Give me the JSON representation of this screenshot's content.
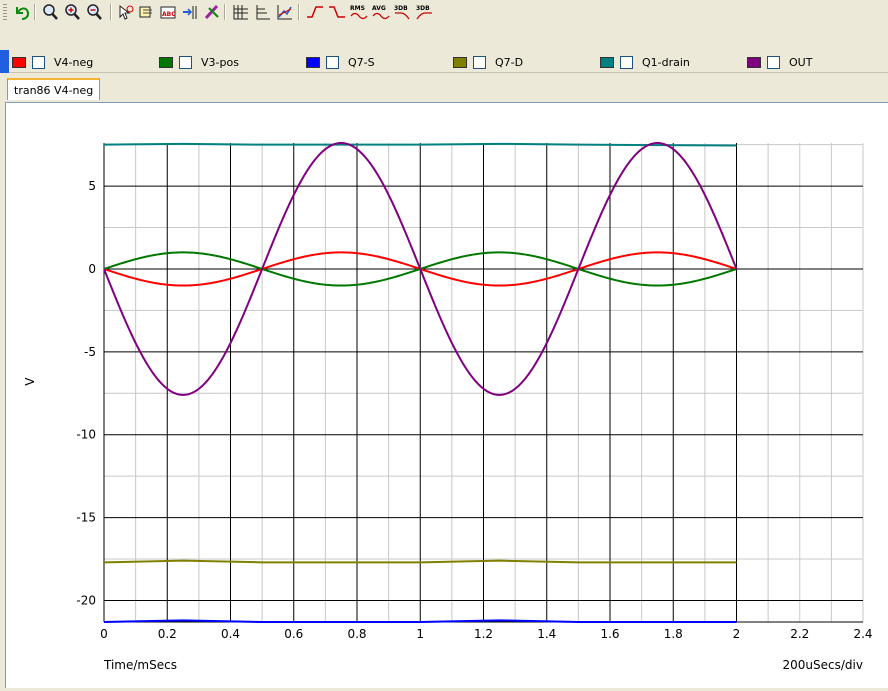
{
  "toolbar": {
    "buttons": [
      {
        "name": "undo",
        "icon": "undo-icon"
      },
      {
        "name": "zoom",
        "icon": "zoom-icon"
      },
      {
        "name": "zoom-in",
        "icon": "zoom-in-icon"
      },
      {
        "name": "zoom-out",
        "icon": "zoom-out-icon"
      },
      {
        "name": "cursor",
        "icon": "cursor-icon"
      },
      {
        "name": "pan",
        "icon": "pan-icon"
      },
      {
        "name": "label",
        "icon": "label-icon"
      },
      {
        "name": "insert",
        "icon": "insert-icon"
      },
      {
        "name": "marker",
        "icon": "marker-icon"
      },
      {
        "name": "grid",
        "icon": "grid-icon"
      },
      {
        "name": "axis",
        "icon": "axis-icon"
      },
      {
        "name": "scale",
        "icon": "scale-icon"
      },
      {
        "name": "rise",
        "icon": "rise-edge-icon"
      },
      {
        "name": "fall",
        "icon": "fall-edge-icon"
      },
      {
        "name": "rms",
        "icon": "rms-icon",
        "label": "RMS"
      },
      {
        "name": "avg",
        "icon": "avg-icon",
        "label": "AVG"
      },
      {
        "name": "3db-a",
        "icon": "3db-low-icon",
        "label": "3DB"
      },
      {
        "name": "3db-b",
        "icon": "3db-high-icon",
        "label": "3DB"
      }
    ]
  },
  "legend": [
    {
      "label": "V4-neg",
      "color": "#ff0000"
    },
    {
      "label": "V3-pos",
      "color": "#007700"
    },
    {
      "label": "Q7-S",
      "color": "#0000ff"
    },
    {
      "label": "Q7-D",
      "color": "#808000"
    },
    {
      "label": "Q1-drain",
      "color": "#008080"
    },
    {
      "label": "OUT",
      "color": "#800080"
    }
  ],
  "tab": {
    "label": "tran86 V4-neg"
  },
  "chart_data": {
    "type": "line",
    "xlabel": "Time/mSecs",
    "ylabel": "V",
    "xdiv_label": "200uSecs/div",
    "xlim": [
      0,
      2.4
    ],
    "ylim": [
      -21.3,
      7.6
    ],
    "xticks": [
      0,
      0.2,
      0.4,
      0.6,
      0.8,
      1,
      1.2,
      1.4,
      1.6,
      1.8,
      2,
      2.2,
      2.4
    ],
    "xtick_labels": [
      "0",
      "0.2",
      "0.4",
      "0.6",
      "0.8",
      "1",
      "1.2",
      "1.4",
      "1.6",
      "1.8",
      "2",
      "2.2",
      "2.4"
    ],
    "yticks": [
      5,
      0,
      -5,
      -10,
      -15,
      -20
    ],
    "ytick_labels": [
      "5",
      "0",
      "-5",
      "-10",
      "-15",
      "-20"
    ],
    "grid": true,
    "series": [
      {
        "name": "V4-neg",
        "color": "#ff0000",
        "x": [
          0,
          0.25,
          0.5,
          0.75,
          1,
          1.25,
          1.5,
          1.75,
          2
        ],
        "values": [
          0,
          -1,
          0,
          1,
          0,
          -1,
          0,
          1,
          0
        ]
      },
      {
        "name": "V3-pos",
        "color": "#007700",
        "x": [
          0,
          0.25,
          0.5,
          0.75,
          1,
          1.25,
          1.5,
          1.75,
          2
        ],
        "values": [
          0,
          1,
          0,
          -1,
          0,
          1,
          0,
          -1,
          0
        ]
      },
      {
        "name": "Q7-S",
        "color": "#0000ff",
        "x": [
          0,
          0.25,
          0.5,
          1,
          1.25,
          1.5,
          2
        ],
        "values": [
          -21.3,
          -21.2,
          -21.3,
          -21.3,
          -21.2,
          -21.3,
          -21.3
        ]
      },
      {
        "name": "Q7-D",
        "color": "#808000",
        "x": [
          0,
          0.25,
          0.5,
          1,
          1.25,
          1.5,
          2
        ],
        "values": [
          -17.7,
          -17.6,
          -17.7,
          -17.7,
          -17.6,
          -17.7,
          -17.7
        ]
      },
      {
        "name": "Q1-drain",
        "color": "#008080",
        "x": [
          0,
          0.25,
          0.5,
          1,
          1.25,
          1.5,
          2
        ],
        "values": [
          7.5,
          7.55,
          7.5,
          7.5,
          7.55,
          7.5,
          7.45
        ]
      },
      {
        "name": "OUT",
        "color": "#800080",
        "x": [
          0,
          0.25,
          0.5,
          0.75,
          1,
          1.25,
          1.5,
          1.75,
          2
        ],
        "values": [
          0,
          -7.6,
          0,
          7.6,
          0,
          -7.6,
          0,
          7.6,
          0
        ]
      }
    ]
  }
}
